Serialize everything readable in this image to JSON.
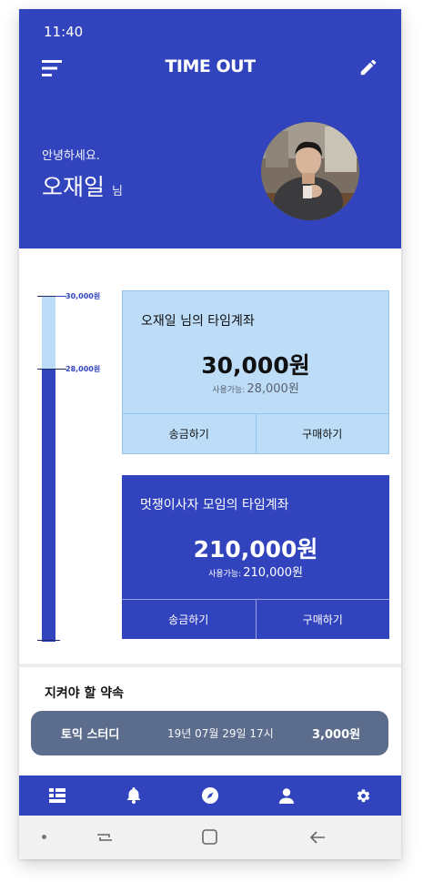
{
  "status_bar": {
    "time": "11:40"
  },
  "header": {
    "title": "TIME OUT",
    "greeting": "안녕하세요.",
    "user_name": "오재일",
    "user_suffix": "님"
  },
  "gauge": {
    "top_label": "30,000원",
    "mid_label": "28,000원",
    "fill_fraction": 0.79
  },
  "accounts": [
    {
      "title": "오재일 님의 타임계좌",
      "amount": "30,000원",
      "available_label": "사용가능:",
      "available": "28,000원",
      "send_label": "송금하기",
      "buy_label": "구매하기"
    },
    {
      "title": "멋쟁이사자 모임의 타임계좌",
      "amount": "210,000원",
      "available_label": "사용가능:",
      "available": "210,000원",
      "send_label": "송금하기",
      "buy_label": "구매하기"
    }
  ],
  "promises": {
    "title": "지켜야 할 약속",
    "items": [
      {
        "name": "토익 스터디",
        "date": "19년 07월 29일 17시",
        "amount": "3,000원"
      }
    ]
  },
  "colors": {
    "primary": "#3244bd",
    "light": "#bcdcf7",
    "promise_bg": "#5b6c8c"
  },
  "bottom_nav": [
    "dashboard-icon",
    "bell-icon",
    "compass-icon",
    "person-icon",
    "gear-icon"
  ]
}
